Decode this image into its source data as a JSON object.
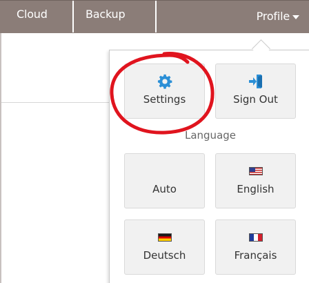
{
  "nav": {
    "tabs": [
      {
        "label": "Cloud"
      },
      {
        "label": "Backup"
      }
    ],
    "profile_label": "Profile"
  },
  "menu": {
    "settings": {
      "label": "Settings",
      "icon": "gear-icon"
    },
    "sign_out": {
      "label": "Sign Out",
      "icon": "sign-out-icon"
    },
    "language_heading": "Language",
    "languages": [
      {
        "label": "Auto",
        "icon": ""
      },
      {
        "label": "English",
        "icon": "us-flag-icon"
      },
      {
        "label": "Deutsch",
        "icon": "german-flag-icon"
      },
      {
        "label": "Français",
        "icon": "french-flag-icon"
      }
    ]
  },
  "colors": {
    "topbar": "#8b7d78",
    "icon_blue": "#2b8fd6",
    "highlight_red": "#e0141e"
  }
}
